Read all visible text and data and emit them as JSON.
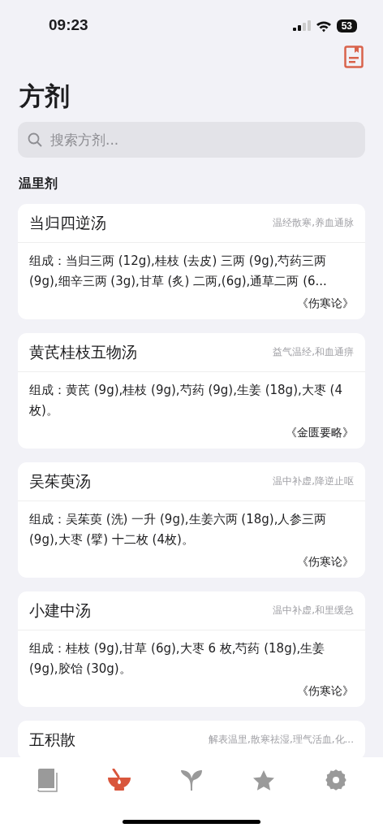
{
  "status_bar": {
    "time": "09:23",
    "battery": "53"
  },
  "title": "方剂",
  "search": {
    "placeholder": "搜索方剂..."
  },
  "section": "温里剂",
  "formulas": [
    {
      "name": "当归四逆汤",
      "effect": "温经散寒,养血通脉",
      "composition": "组成：当归三两 (12g),桂枝 (去皮) 三两 (9g),芍药三两 (9g),细辛三两 (3g),甘草 (炙) 二两,(6g),通草二两 (6...",
      "source": "《伤寒论》"
    },
    {
      "name": "黄芪桂枝五物汤",
      "effect": "益气温经,和血通痹",
      "composition": "组成：黄芪 (9g),桂枝 (9g),芍药 (9g),生姜 (18g),大枣 (4枚)。",
      "source": "《金匮要略》"
    },
    {
      "name": "吴茱萸汤",
      "effect": "温中补虚,降逆止呕",
      "composition": "组成：吴茱萸 (洗) 一升 (9g),生姜六两 (18g),人参三两 (9g),大枣 (擘) 十二枚 (4枚)。",
      "source": "《伤寒论》"
    },
    {
      "name": "小建中汤",
      "effect": "温中补虚,和里缓急",
      "composition": "组成：桂枝 (9g),甘草 (6g),大枣 6 枚,芍药 (18g),生姜 (9g),胶饴 (30g)。",
      "source": "《伤寒论》"
    },
    {
      "name": "五积散",
      "effect": "解表温里,散寒祛湿,理气活血,化..."
    }
  ],
  "tabs": [
    {
      "kind": "book",
      "selected": false
    },
    {
      "kind": "mortar",
      "selected": true
    },
    {
      "kind": "leaf",
      "selected": false
    },
    {
      "kind": "star",
      "selected": false
    },
    {
      "kind": "gear",
      "selected": false
    }
  ]
}
